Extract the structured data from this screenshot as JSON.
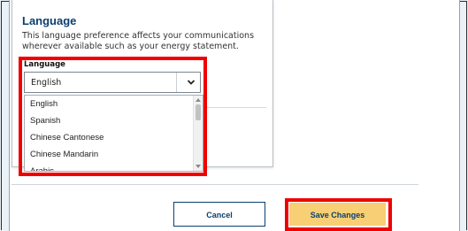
{
  "card": {
    "title": "Language",
    "description": "This language preference affects your communications wherever available such as your energy statement."
  },
  "language_select": {
    "label": "Language",
    "selected": "English",
    "options": [
      "English",
      "Spanish",
      "Chinese Cantonese",
      "Chinese Mandarin",
      "Arabic"
    ]
  },
  "buttons": {
    "cancel": "Cancel",
    "save": "Save Changes"
  },
  "icons": {
    "select_arrow": "chevron-down-icon"
  },
  "colors": {
    "title_blue": "#0b3f6f",
    "save_button": "#f8cf74",
    "highlight_red": "#ef0000",
    "background": "#eaf2f8"
  }
}
